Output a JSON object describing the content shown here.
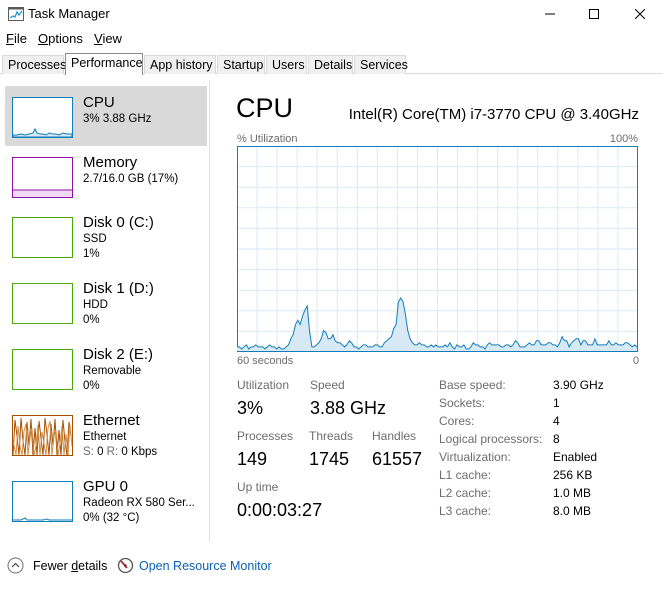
{
  "window": {
    "title": "Task Manager",
    "icon": "task-manager-icon",
    "controls": [
      "minimize-icon",
      "maximize-icon",
      "close-icon"
    ]
  },
  "menu": [
    {
      "label": "File",
      "accel": "F",
      "rest": "ile"
    },
    {
      "label": "Options",
      "accel": "O",
      "rest": "ptions"
    },
    {
      "label": "View",
      "accel": "V",
      "rest": "iew"
    }
  ],
  "tabs": [
    "Processes",
    "Performance",
    "App history",
    "Startup",
    "Users",
    "Details",
    "Services"
  ],
  "active_tab": "Performance",
  "sidebar": {
    "items": [
      {
        "title": "CPU",
        "line2": "3% 3.88 GHz",
        "line3": "",
        "color": "#117dbb"
      },
      {
        "title": "Memory",
        "line2": "2.7/16.0 GB (17%)",
        "line3": "",
        "color": "#8b12ae"
      },
      {
        "title": "Disk 0 (C:)",
        "line2": "SSD",
        "line3": "1%",
        "color": "#4da60c"
      },
      {
        "title": "Disk 1 (D:)",
        "line2": "HDD",
        "line3": "0%",
        "color": "#4da60c"
      },
      {
        "title": "Disk 2 (E:)",
        "line2": "Removable",
        "line3": "0%",
        "color": "#4da60c"
      },
      {
        "title": "Ethernet",
        "line2": "Ethernet",
        "line3_s": "S:",
        "line3_sv": " 0 ",
        "line3_r": "R:",
        "line3_rv": " 0 Kbps",
        "color": "#a74f01"
      },
      {
        "title": "GPU 0",
        "line2": "Radeon RX 580 Ser...",
        "line3": "0% (32 °C)",
        "color": "#117dbb"
      }
    ]
  },
  "main": {
    "title": "CPU",
    "model": "Intel(R) Core(TM) i7-3770 CPU @ 3.40GHz",
    "graph_label": "% Utilization",
    "graph_max": "100%",
    "graph_time": "60 seconds",
    "graph_min": "0",
    "graph_color": "#117dbb",
    "graph_series": [
      2,
      2,
      1,
      2,
      3,
      1,
      2,
      2,
      3,
      2,
      2,
      2,
      1,
      2,
      3,
      2,
      2,
      1,
      2,
      1,
      1,
      2,
      3,
      6,
      8,
      13,
      15,
      13,
      17,
      20,
      22,
      10,
      2,
      2,
      3,
      4,
      6,
      10,
      9,
      6,
      6,
      8,
      5,
      4,
      4,
      3,
      2,
      3,
      5,
      4,
      2,
      2,
      1,
      2,
      3,
      3,
      2,
      2,
      2,
      3,
      3,
      2,
      2,
      4,
      5,
      6,
      7,
      11,
      13,
      24,
      26,
      24,
      18,
      10,
      6,
      4,
      3,
      3,
      4,
      3,
      3,
      2,
      2,
      3,
      2,
      3,
      2,
      2,
      2,
      3,
      2,
      4,
      2,
      1,
      3,
      2,
      2,
      3,
      1,
      1,
      2,
      4,
      3,
      3,
      2,
      2,
      1,
      3,
      4,
      3,
      3,
      3,
      3,
      2,
      2,
      3,
      3,
      2,
      3,
      5,
      4,
      2,
      2,
      2,
      3,
      4,
      3,
      3,
      5,
      5,
      3,
      3,
      3,
      4,
      4,
      3,
      3,
      2,
      4,
      7,
      5,
      5,
      2,
      4,
      5,
      6,
      6,
      3,
      5,
      5,
      3,
      3,
      3,
      6,
      3,
      3,
      3,
      3,
      3,
      5,
      3,
      3,
      4,
      3,
      3,
      3,
      4,
      4,
      3,
      2,
      3,
      2
    ],
    "stats": {
      "utilization_label": "Utilization",
      "utilization": "3%",
      "speed_label": "Speed",
      "speed": "3.88 GHz",
      "processes_label": "Processes",
      "processes": "149",
      "threads_label": "Threads",
      "threads": "1745",
      "handles_label": "Handles",
      "handles": "61557",
      "uptime_label": "Up time",
      "uptime": "0:00:03:27"
    },
    "details": [
      {
        "label": "Base speed:",
        "value": "3.90 GHz"
      },
      {
        "label": "Sockets:",
        "value": "1"
      },
      {
        "label": "Cores:",
        "value": "4"
      },
      {
        "label": "Logical processors:",
        "value": "8"
      },
      {
        "label": "Virtualization:",
        "value": "Enabled"
      },
      {
        "label": "L1 cache:",
        "value": "256 KB"
      },
      {
        "label": "L2 cache:",
        "value": "1.0 MB"
      },
      {
        "label": "L3 cache:",
        "value": "8.0 MB"
      }
    ]
  },
  "footer": {
    "fewer_pre": "Fewer ",
    "fewer_accel": "d",
    "fewer_post": "etails",
    "open_resource_monitor": "Open Resource Monitor"
  }
}
